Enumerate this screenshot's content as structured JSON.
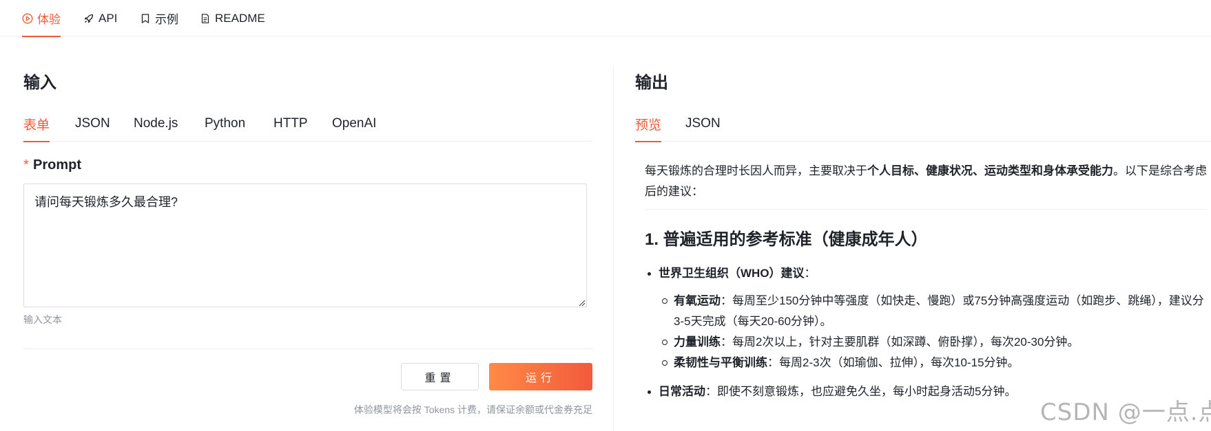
{
  "topnav": {
    "tabs": [
      {
        "label": "体验",
        "icon": "play-circle-icon",
        "active": true
      },
      {
        "label": "API",
        "icon": "rocket-icon",
        "active": false
      },
      {
        "label": "示例",
        "icon": "bookmark-icon",
        "active": false
      },
      {
        "label": "README",
        "icon": "document-icon",
        "active": false
      }
    ]
  },
  "input": {
    "title": "输入",
    "tabs": [
      "表单",
      "JSON",
      "Node.js",
      "Python",
      "HTTP",
      "OpenAI"
    ],
    "active_tab": "表单",
    "required_mark": "*",
    "field_label": "Prompt",
    "prompt_value": "请问每天锻炼多久最合理?",
    "helper": "输入文本",
    "reset_label": "重置",
    "run_label": "运行",
    "footnote": "体验模型将会按 Tokens 计费，请保证余额或代金券充足"
  },
  "output": {
    "title": "输出",
    "tabs": [
      "预览",
      "JSON"
    ],
    "active_tab": "预览",
    "intro_pre": "每天锻炼的合理时长因人而异，主要取决于",
    "intro_bold": "个人目标、健康状况、运动类型和身体承受能力",
    "intro_post": "。以下是综合考虑后的建议：",
    "heading": "1. 普遍适用的参考标准（健康成年人）",
    "bullets": [
      {
        "label": "世界卫生组织（WHO）建议",
        "text": "：",
        "sub": [
          {
            "label": "有氧运动",
            "text": "：每周至少150分钟中等强度（如快走、慢跑）或75分钟高强度运动（如跑步、跳绳），建议分3-5天完成（每天20-60分钟）。"
          },
          {
            "label": "力量训练",
            "text": "：每周2次以上，针对主要肌群（如深蹲、俯卧撑），每次20-30分钟。"
          },
          {
            "label": "柔韧性与平衡训练",
            "text": "：每周2-3次（如瑜伽、拉伸），每次10-15分钟。"
          }
        ]
      },
      {
        "label": "日常活动",
        "text": "：即使不刻意锻炼，也应避免久坐，每小时起身活动5分钟。",
        "sub": []
      }
    ]
  },
  "watermark": "CSDN @一点.点",
  "colors": {
    "accent": "#ee5a38",
    "run_gradient_start": "#ff8a45",
    "run_gradient_end": "#f25a3c"
  }
}
